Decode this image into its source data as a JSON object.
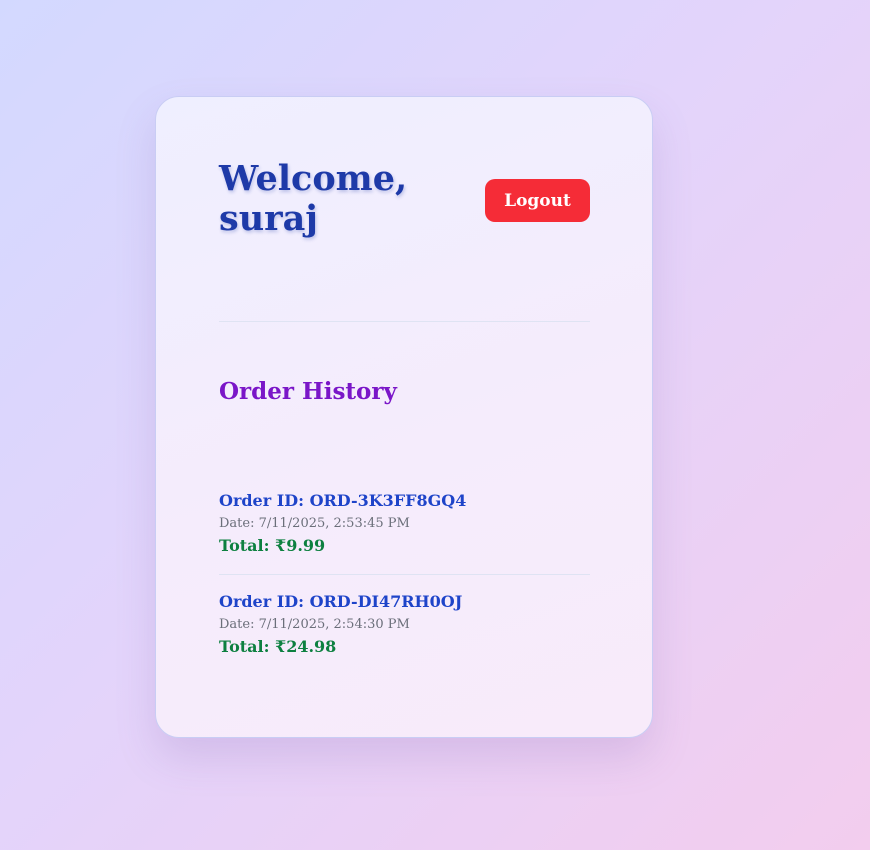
{
  "header": {
    "welcome_text": "Welcome, suraj",
    "logout_label": "Logout"
  },
  "orders_section": {
    "title": "Order History",
    "orders": [
      {
        "id_text": "Order ID: ORD-3K3FF8GQ4",
        "date_text": "Date: 7/11/2025, 2:53:45 PM",
        "total_text": "Total: ₹9.99"
      },
      {
        "id_text": "Order ID: ORD-DI47RH0OJ",
        "date_text": "Date: 7/11/2025, 2:54:30 PM",
        "total_text": "Total: ₹24.98"
      }
    ]
  },
  "colors": {
    "heading": "#1e3aa8",
    "logout_button": "#f52c37",
    "section_title": "#7a16c8",
    "order_id": "#1e44c9",
    "order_total": "#0d8040"
  }
}
